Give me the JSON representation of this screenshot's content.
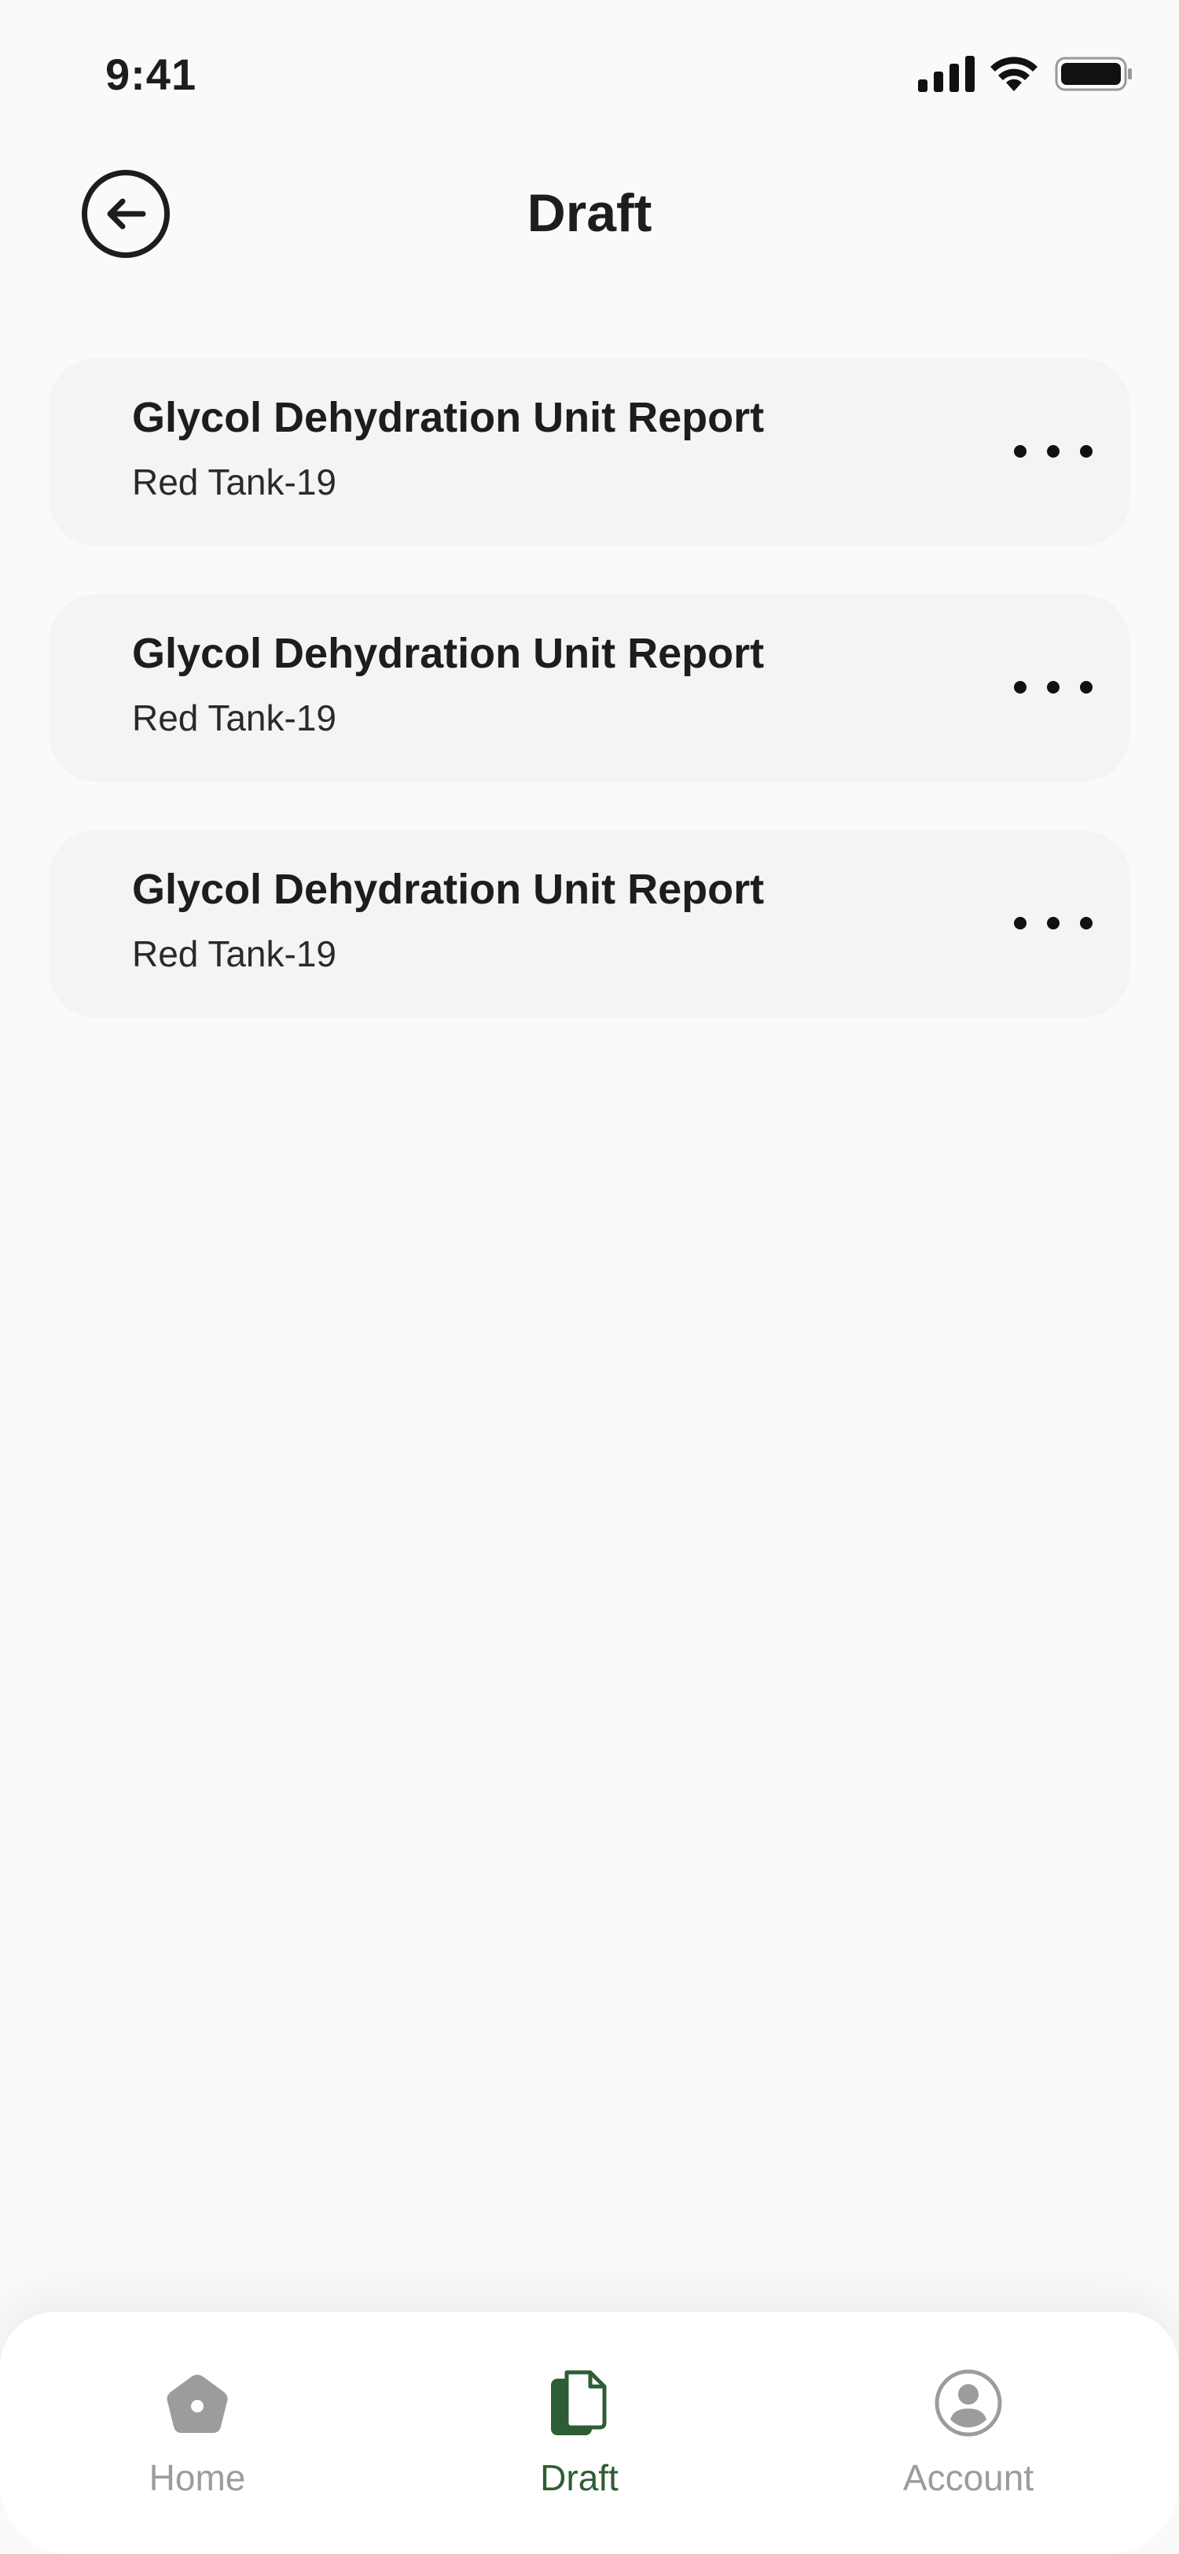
{
  "status_bar": {
    "time": "9:41"
  },
  "header": {
    "title": "Draft"
  },
  "drafts": [
    {
      "title": "Glycol Dehydration Unit Report",
      "subtitle": "Red Tank-19"
    },
    {
      "title": "Glycol Dehydration Unit Report",
      "subtitle": "Red Tank-19"
    },
    {
      "title": "Glycol Dehydration Unit Report",
      "subtitle": "Red Tank-19"
    }
  ],
  "bottom_nav": {
    "items": [
      {
        "label": "Home",
        "icon": "home-icon"
      },
      {
        "label": "Draft",
        "icon": "document-icon",
        "active": true
      },
      {
        "label": "Account",
        "icon": "account-icon"
      }
    ]
  },
  "colors": {
    "accent": "#2e5d34",
    "inactive": "#9c9c9c",
    "card": "#f4f4f4",
    "background": "#fafafa"
  }
}
